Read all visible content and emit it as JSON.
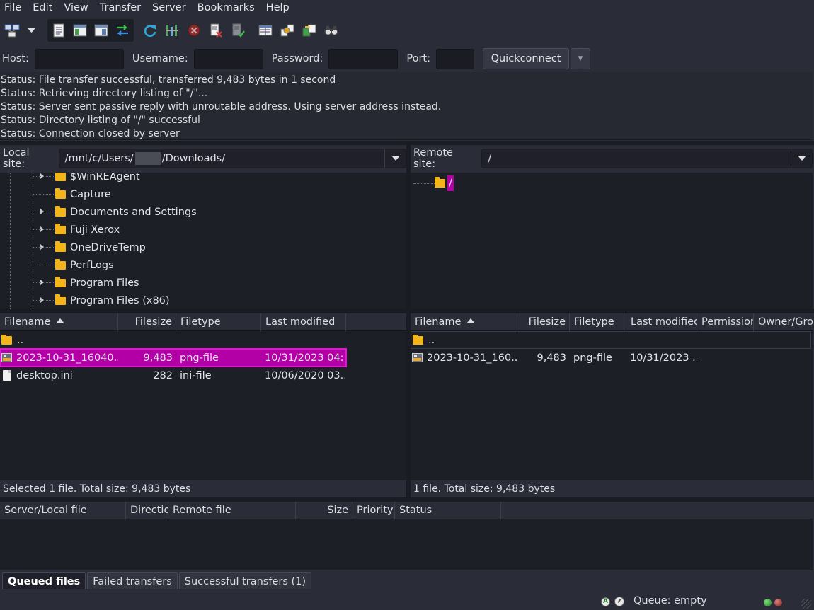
{
  "menubar": {
    "items": [
      "File",
      "Edit",
      "View",
      "Transfer",
      "Server",
      "Bookmarks",
      "Help"
    ]
  },
  "toolbar": {
    "icons": [
      "site-manager-icon",
      "site-manager-dropdown-icon",
      "toggle-message-log-icon",
      "toggle-local-tree-icon",
      "toggle-remote-tree-icon",
      "toggle-transfer-queue-icon",
      "refresh-icon",
      "process-queue-icon",
      "cancel-icon",
      "disconnect-icon",
      "reconnect-icon",
      "directory-listing-filters-icon",
      "toggle-sync-browsing-icon",
      "directory-comparison-icon",
      "search-remote-files-icon"
    ]
  },
  "quickconnect": {
    "host_label": "Host:",
    "host_value": "",
    "username_label": "Username:",
    "username_value": "",
    "password_label": "Password:",
    "password_value": "",
    "port_label": "Port:",
    "port_value": "",
    "button_label": "Quickconnect"
  },
  "log": {
    "lines": [
      "Status: File transfer successful, transferred 9,483 bytes in 1 second",
      "Status: Retrieving directory listing of \"/\"...",
      "Status: Server sent passive reply with unroutable address. Using server address instead.",
      "Status: Directory listing of \"/\" successful",
      "Status: Connection closed by server"
    ]
  },
  "local": {
    "site_label": "Local site:",
    "path_before": "/mnt/c/Users/",
    "path_after": "/Downloads/",
    "tree": [
      {
        "name": "$WinREAgent",
        "expandable": true
      },
      {
        "name": "Capture",
        "expandable": false
      },
      {
        "name": "Documents and Settings",
        "expandable": true
      },
      {
        "name": "Fuji Xerox",
        "expandable": true
      },
      {
        "name": "OneDriveTemp",
        "expandable": true
      },
      {
        "name": "PerfLogs",
        "expandable": false
      },
      {
        "name": "Program Files",
        "expandable": true
      },
      {
        "name": "Program Files (x86)",
        "expandable": true
      }
    ],
    "columns": [
      "Filename",
      "Filesize",
      "Filetype",
      "Last modified"
    ],
    "files": [
      {
        "name": "..",
        "size": "",
        "type": "",
        "modified": "",
        "icon": "folder-icon"
      },
      {
        "name": "2023-10-31_16040...",
        "size": "9,483",
        "type": "png-file",
        "modified": "10/31/2023 04:...",
        "icon": "image-file-icon",
        "selected": true
      },
      {
        "name": "desktop.ini",
        "size": "282",
        "type": "ini-file",
        "modified": "10/06/2020 03...",
        "icon": "file-icon"
      }
    ],
    "status": "Selected 1 file. Total size: 9,483 bytes"
  },
  "remote": {
    "site_label": "Remote site:",
    "path": "/",
    "tree": [
      {
        "name": "/"
      }
    ],
    "columns": [
      "Filename",
      "Filesize",
      "Filetype",
      "Last modified",
      "Permission",
      "Owner/Grou"
    ],
    "files": [
      {
        "name": "..",
        "size": "",
        "type": "",
        "modified": "",
        "icon": "folder-icon"
      },
      {
        "name": "2023-10-31_160...",
        "size": "9,483",
        "type": "png-file",
        "modified": "10/31/2023 ...",
        "icon": "image-file-icon"
      }
    ],
    "status": "1 file. Total size: 9,483 bytes"
  },
  "queue": {
    "columns": [
      "Server/Local file",
      "Directio",
      "Remote file",
      "Size",
      "Priority",
      "Status"
    ],
    "tabs": [
      "Queued files",
      "Failed transfers",
      "Successful transfers (1)"
    ],
    "status": "Queue: empty"
  },
  "colors": {
    "background": "#2a2c37",
    "panel": "#1d1f27",
    "selection": "#b200a6",
    "folder": "#f3b51a"
  }
}
